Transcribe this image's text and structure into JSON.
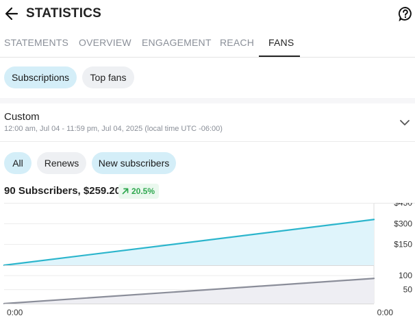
{
  "header": {
    "title": "STATISTICS",
    "back_icon": "arrow-left-icon",
    "help_icon": "question-circle-icon"
  },
  "tabs": [
    {
      "label": "STATEMENTS",
      "active": false
    },
    {
      "label": "OVERVIEW",
      "active": false
    },
    {
      "label": "ENGAGEMENT",
      "active": false
    },
    {
      "label": "REACH",
      "active": false
    },
    {
      "label": "FANS",
      "active": true
    }
  ],
  "view_chips": [
    {
      "label": "Subscriptions",
      "selected": true
    },
    {
      "label": "Top fans",
      "selected": false
    }
  ],
  "date_filter": {
    "title": "Custom",
    "range": "12:00 am, Jul 04 - 11:59 pm, Jul 04, 2025 (local time UTC -06:00)",
    "icon": "chevron-down-icon"
  },
  "type_chips": [
    {
      "label": "All",
      "selected": true
    },
    {
      "label": "Renews",
      "selected": false
    },
    {
      "label": "New subscribers",
      "selected": true
    }
  ],
  "summary": {
    "text": "90 Subscribers, $259.20",
    "delta": "20.5%",
    "delta_icon": "arrow-up-right-icon"
  },
  "colors": {
    "accent": "#2bb5cc",
    "accent_fill": "#dff4fb",
    "secondary_line": "#8a8d99",
    "positive": "#2fa84f",
    "selected_chip": "#d4eef8"
  },
  "chart_data": [
    {
      "type": "area",
      "ylim": [
        0,
        450
      ],
      "yticks": [
        "$450",
        "$300",
        "$150"
      ],
      "series": [
        {
          "values": [
            0,
            330
          ]
        }
      ],
      "color": "#2bb5cc"
    },
    {
      "type": "area",
      "ylim": [
        0,
        120
      ],
      "yticks": [
        "100",
        "50"
      ],
      "xticks": [
        "0:00",
        "0:00"
      ],
      "series": [
        {
          "values": [
            0,
            90
          ]
        }
      ],
      "color": "#8a8d99"
    }
  ]
}
